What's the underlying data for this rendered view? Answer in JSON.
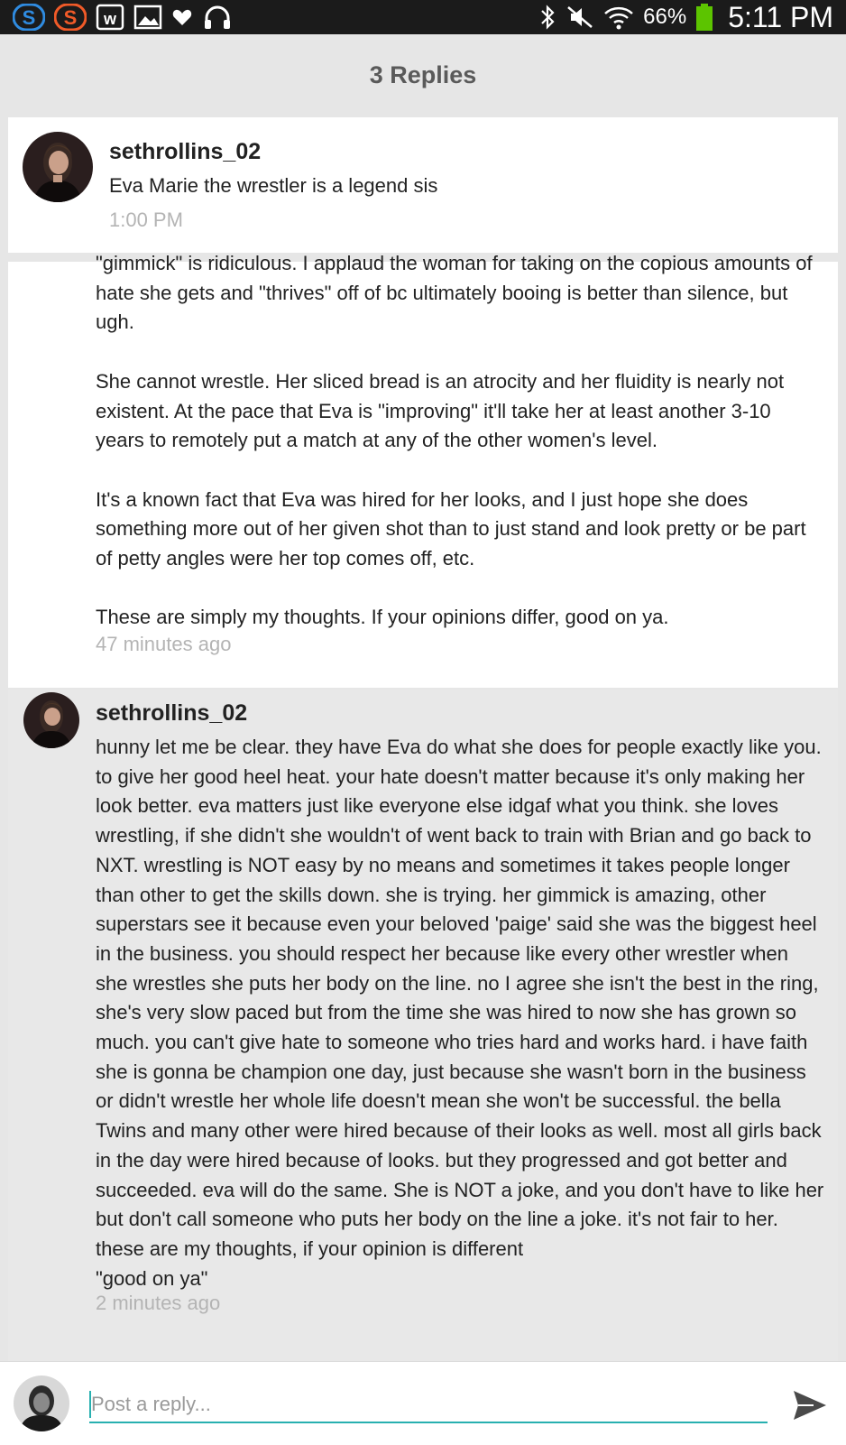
{
  "status_bar": {
    "battery_percent": "66%",
    "time": "5:11 PM",
    "left_icons": [
      "s-app-icon-blue",
      "s-app-icon-orange",
      "w-app-icon",
      "gallery-icon",
      "heart-icon",
      "headphones-icon"
    ],
    "right_icons": [
      "bluetooth-icon",
      "mute-icon",
      "wifi-icon",
      "battery-icon"
    ],
    "battery_color": "#5cc400"
  },
  "header": {
    "title": "3 Replies"
  },
  "original_post": {
    "username": "sethrollins_02",
    "text": "Eva Marie the wrestler is a legend sis",
    "time": "1:00 PM"
  },
  "reply_1": {
    "text": "\"gimmick\" is ridiculous. I applaud the woman for taking on the copious amounts of hate she gets and \"thrives\" off of bc ultimately booing is better than silence, but ugh.\n\nShe cannot wrestle. Her sliced bread is an atrocity and her fluidity is nearly not existent. At the pace that Eva is \"improving\" it'll take her at least another 3-10 years to remotely put a match at any of the other women's level.\n\nIt's a known fact that Eva was hired for her looks, and I just hope she does something more out of her given shot than to just stand and look pretty or be part of petty angles were her top comes off, etc.\n\nThese are simply my thoughts. If your opinions differ, good on ya.",
    "time": "47 minutes ago"
  },
  "reply_2": {
    "username": "sethrollins_02",
    "text": "hunny let me be clear. they have Eva do what she does for people exactly like you. to give her good heel heat. your hate doesn't matter because it's only making her look better. eva matters just like everyone else idgaf what you think. she loves wrestling, if she didn't she wouldn't of went back to train with Brian and go back to NXT. wrestling is NOT easy by no means and sometimes it takes people longer than other to get the skills down. she is trying. her gimmick is amazing, other superstars see it because even your beloved 'paige' said she was the biggest heel in the business. you should respect her because like every other wrestler when  she wrestles she puts her body on the line. no I agree she isn't the best in the ring, she's very slow paced but from the time she was hired to now she has grown so much. you can't give hate to someone who tries hard and works hard. i have faith she is gonna be champion one day, just because she wasn't born in the business or didn't wrestle her whole life doesn't mean she won't be successful. the bella Twins and many other were hired because of their looks as well. most all girls back in the day were hired because of looks. but they progressed and got better and succeeded. eva will do the same. She is NOT a joke, and you don't have to like her but don't call someone who puts her body on the line a joke. it's not fair to her.\nthese are my thoughts, if your opinion is different\n\"good on ya\"",
    "time": "2 minutes ago"
  },
  "composer": {
    "placeholder": "Post a reply...",
    "value": "",
    "accent_color": "#28b0b0"
  }
}
